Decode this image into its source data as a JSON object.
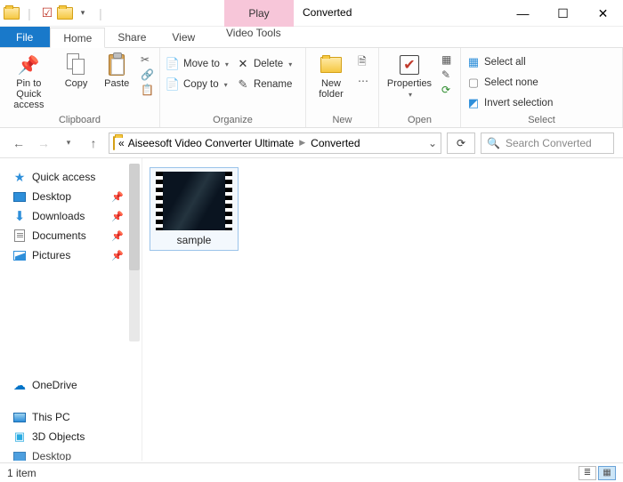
{
  "titlebar": {
    "contextual_label": "Play",
    "window_title": "Converted"
  },
  "tabs": {
    "file": "File",
    "home": "Home",
    "share": "Share",
    "view": "View",
    "video_tools": "Video Tools"
  },
  "ribbon": {
    "clipboard": {
      "label": "Clipboard",
      "pin": "Pin to Quick access",
      "copy": "Copy",
      "paste": "Paste"
    },
    "organize": {
      "label": "Organize",
      "move_to": "Move to",
      "copy_to": "Copy to",
      "delete": "Delete",
      "rename": "Rename"
    },
    "new": {
      "label": "New",
      "new_folder": "New folder"
    },
    "open": {
      "label": "Open",
      "properties": "Properties"
    },
    "select": {
      "label": "Select",
      "select_all": "Select all",
      "select_none": "Select none",
      "invert": "Invert selection"
    }
  },
  "address": {
    "root_prefix": "«",
    "crumb1": "Aiseesoft Video Converter Ultimate",
    "crumb2": "Converted"
  },
  "search": {
    "placeholder": "Search Converted"
  },
  "sidebar": {
    "quick_access": "Quick access",
    "desktop": "Desktop",
    "downloads": "Downloads",
    "documents": "Documents",
    "pictures": "Pictures",
    "onedrive": "OneDrive",
    "this_pc": "This PC",
    "objects_3d": "3D Objects",
    "desktop2": "Desktop"
  },
  "content": {
    "items": [
      {
        "name": "sample"
      }
    ]
  },
  "status": {
    "count_text": "1 item"
  }
}
